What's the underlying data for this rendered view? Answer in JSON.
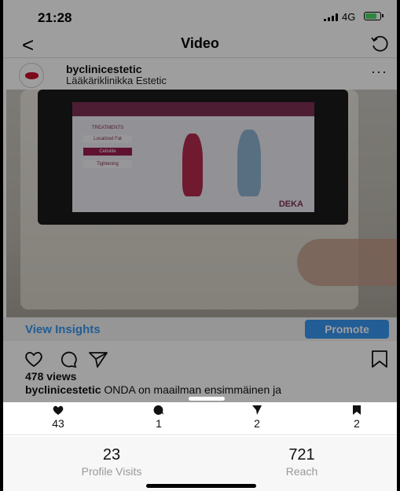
{
  "status_bar": {
    "time": "21:28",
    "network": "4G"
  },
  "nav": {
    "title": "Video",
    "back_glyph": "<"
  },
  "post": {
    "username": "byclinicestetic",
    "subtitle": "Lääkäriklinikka Estetic",
    "more_glyph": "···",
    "device_brand": "DEKA",
    "screen_items": [
      "TREATMENTS",
      "Localized Fat",
      "Cellulite",
      "Tightening"
    ]
  },
  "insights_bar": {
    "view_insights": "View Insights",
    "promote": "Promote"
  },
  "views": "478 views",
  "caption": {
    "user": "byclinicestetic",
    "text": " ONDA on maailman ensimmäinen ja"
  },
  "stats": [
    {
      "icon": "heart-icon",
      "value": "43"
    },
    {
      "icon": "comment-icon",
      "value": "1"
    },
    {
      "icon": "send-icon",
      "value": "2"
    },
    {
      "icon": "bookmark-icon",
      "value": "2"
    }
  ],
  "reach_stats": {
    "profile_visits": {
      "value": "23",
      "label": "Profile Visits"
    },
    "reach": {
      "value": "721",
      "label": "Reach"
    }
  },
  "colors": {
    "accent": "#3897f0",
    "device_brand": "#7d2f55"
  }
}
